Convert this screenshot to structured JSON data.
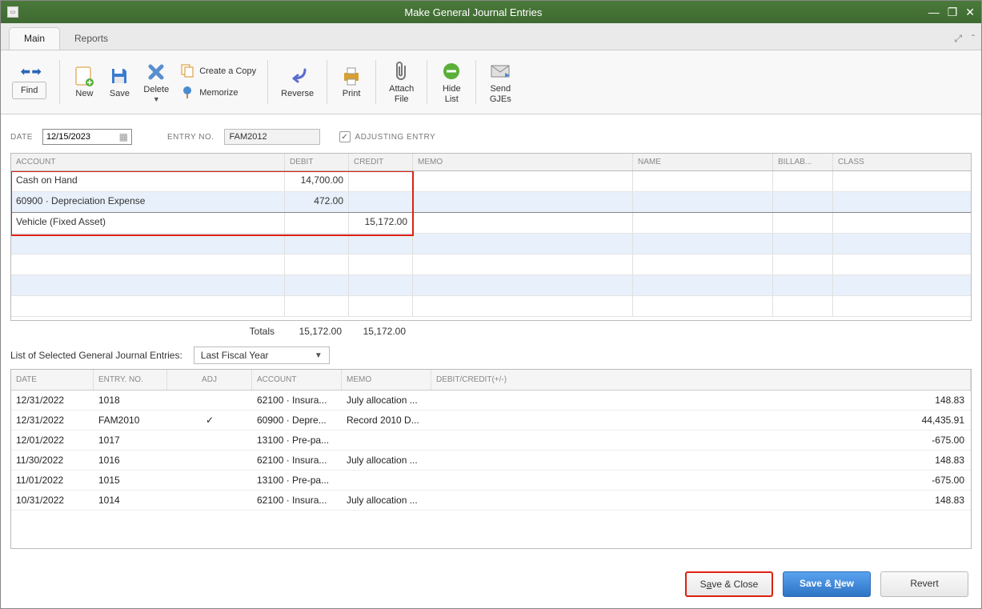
{
  "titlebar": {
    "title": "Make General Journal Entries"
  },
  "tabs": {
    "main": "Main",
    "reports": "Reports"
  },
  "toolbar": {
    "find": "Find",
    "new": "New",
    "save": "Save",
    "delete": "Delete",
    "create_copy": "Create a Copy",
    "memorize": "Memorize",
    "reverse": "Reverse",
    "print": "Print",
    "attach_file": "Attach\nFile",
    "hide_list": "Hide\nList",
    "send_gjes": "Send\nGJEs"
  },
  "form": {
    "date_label": "DATE",
    "date_value": "12/15/2023",
    "entry_label": "ENTRY NO.",
    "entry_value": "FAM2012",
    "adjusting_label": "ADJUSTING ENTRY",
    "adjusting_checked": true
  },
  "grid": {
    "headers": {
      "account": "ACCOUNT",
      "debit": "DEBIT",
      "credit": "CREDIT",
      "memo": "MEMO",
      "name": "NAME",
      "billable": "BILLAB...",
      "class": "CLASS"
    },
    "rows": [
      {
        "account": "Cash on Hand",
        "debit": "14,700.00",
        "credit": ""
      },
      {
        "account": "60900 · Depreciation Expense",
        "debit": "472.00",
        "credit": ""
      },
      {
        "account": "Vehicle (Fixed Asset)",
        "debit": "",
        "credit": "15,172.00"
      }
    ],
    "totals_label": "Totals",
    "total_debit": "15,172.00",
    "total_credit": "15,172.00"
  },
  "list": {
    "title": "List of Selected General Journal Entries:",
    "filter": "Last Fiscal Year",
    "headers": {
      "date": "DATE",
      "entry": "ENTRY. NO.",
      "adj": "ADJ",
      "account": "ACCOUNT",
      "memo": "MEMO",
      "dc": "DEBIT/CREDIT(+/-)"
    },
    "rows": [
      {
        "date": "12/31/2022",
        "entry": "1018",
        "adj": "",
        "account": "62100 · Insura...",
        "memo": "July allocation ...",
        "dc": "148.83"
      },
      {
        "date": "12/31/2022",
        "entry": "FAM2010",
        "adj": "✓",
        "account": "60900 · Depre...",
        "memo": "Record 2010 D...",
        "dc": "44,435.91"
      },
      {
        "date": "12/01/2022",
        "entry": "1017",
        "adj": "",
        "account": "13100 · Pre-pa...",
        "memo": "",
        "dc": "-675.00"
      },
      {
        "date": "11/30/2022",
        "entry": "1016",
        "adj": "",
        "account": "62100 · Insura...",
        "memo": "July allocation ...",
        "dc": "148.83"
      },
      {
        "date": "11/01/2022",
        "entry": "1015",
        "adj": "",
        "account": "13100 · Pre-pa...",
        "memo": "",
        "dc": "-675.00"
      },
      {
        "date": "10/31/2022",
        "entry": "1014",
        "adj": "",
        "account": "62100 · Insura...",
        "memo": "July allocation ...",
        "dc": "148.83"
      }
    ]
  },
  "footer": {
    "save_close": "Save & Close",
    "save_new": "Save & New",
    "revert": "Revert"
  }
}
